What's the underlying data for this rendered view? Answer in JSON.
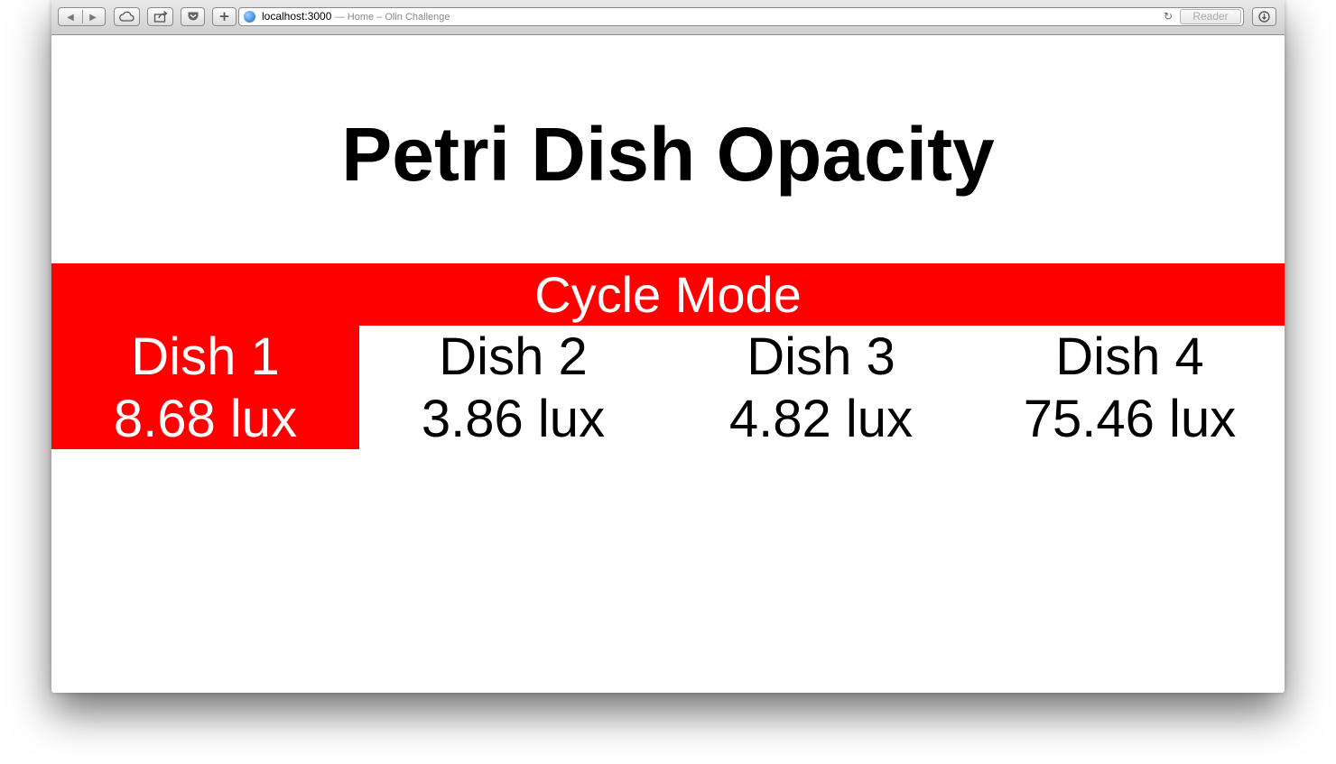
{
  "browser": {
    "url": "localhost:3000",
    "page_title": "— Home – Olin Challenge",
    "reader_label": "Reader",
    "icons": {
      "back": "back-arrow-icon",
      "forward": "forward-arrow-icon",
      "cloud": "icloud-tabs-icon",
      "share": "share-icon",
      "pocket": "pocket-icon",
      "new_tab": "plus-icon",
      "reload": "reload-icon",
      "downloads": "downloads-icon",
      "site": "globe-icon"
    }
  },
  "page": {
    "title": "Petri Dish Opacity",
    "mode_label": "Cycle Mode",
    "accent_color": "#ff0000",
    "dishes": [
      {
        "name": "Dish 1",
        "value": "8.68 lux",
        "active": true
      },
      {
        "name": "Dish 2",
        "value": "3.86 lux",
        "active": false
      },
      {
        "name": "Dish 3",
        "value": "4.82 lux",
        "active": false
      },
      {
        "name": "Dish 4",
        "value": "75.46 lux",
        "active": false
      }
    ]
  }
}
